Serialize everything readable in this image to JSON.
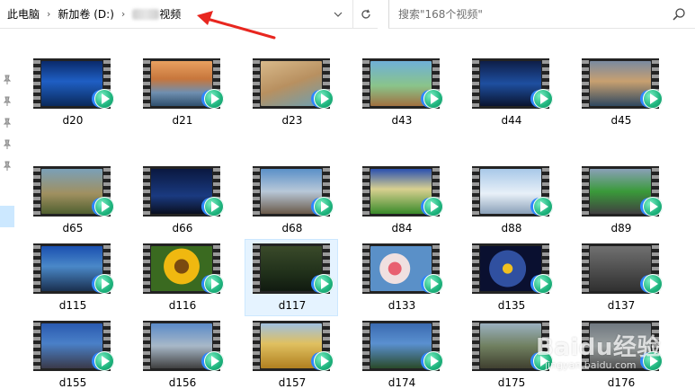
{
  "address": {
    "crumbs": [
      "此电脑",
      "新加卷 (D:)",
      "视频"
    ],
    "separator": "›"
  },
  "search": {
    "placeholder": "搜索\"168个视频\""
  },
  "files": [
    {
      "name": "d20"
    },
    {
      "name": "d21"
    },
    {
      "name": "d23"
    },
    {
      "name": "d43"
    },
    {
      "name": "d44"
    },
    {
      "name": "d45"
    },
    {
      "name": "d65"
    },
    {
      "name": "d66"
    },
    {
      "name": "d68"
    },
    {
      "name": "d84"
    },
    {
      "name": "d88"
    },
    {
      "name": "d89"
    },
    {
      "name": "d115"
    },
    {
      "name": "d116"
    },
    {
      "name": "d117"
    },
    {
      "name": "d133"
    },
    {
      "name": "d135"
    },
    {
      "name": "d137"
    },
    {
      "name": "d155"
    },
    {
      "name": "d156"
    },
    {
      "name": "d157"
    },
    {
      "name": "d174"
    },
    {
      "name": "d175"
    },
    {
      "name": "d176"
    }
  ],
  "selected_file": "d117",
  "watermark": {
    "text": "Baidu经验",
    "sub": "jingyan.baidu.com"
  }
}
